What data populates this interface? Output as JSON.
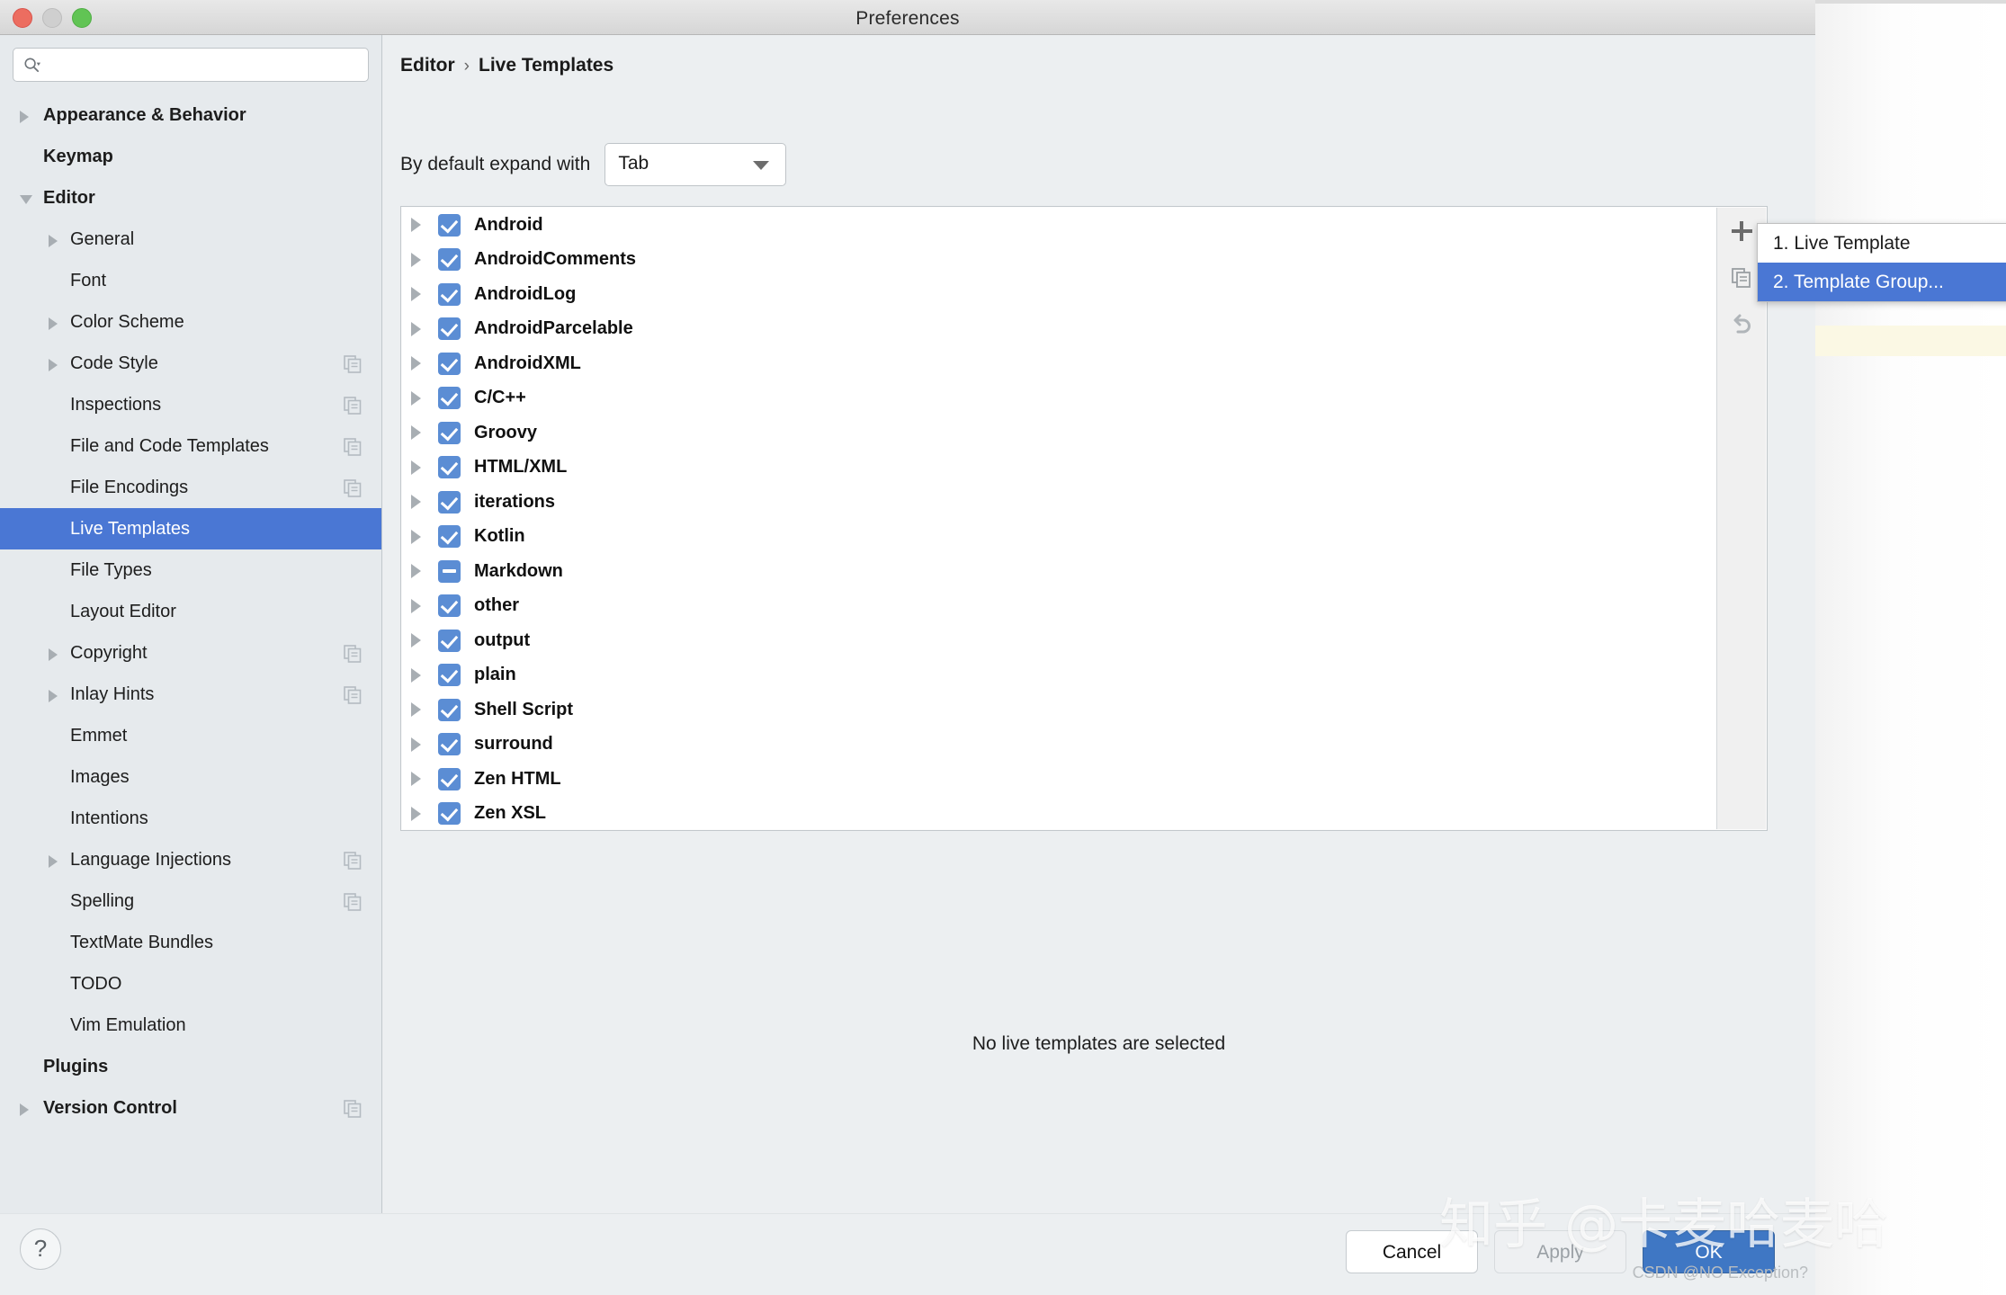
{
  "window": {
    "title": "Preferences",
    "traffic_lights": [
      "close",
      "minimize",
      "maximize"
    ]
  },
  "sidebar": {
    "search": {
      "value": "",
      "placeholder": ""
    },
    "items": [
      {
        "label": "Appearance & Behavior",
        "level": 0,
        "twisty": "closed",
        "bold": true,
        "copy": false,
        "selected": false
      },
      {
        "label": "Keymap",
        "level": 0,
        "twisty": "none",
        "bold": true,
        "copy": false,
        "selected": false
      },
      {
        "label": "Editor",
        "level": 0,
        "twisty": "open",
        "bold": true,
        "copy": false,
        "selected": false
      },
      {
        "label": "General",
        "level": 1,
        "twisty": "closed",
        "bold": false,
        "copy": false,
        "selected": false
      },
      {
        "label": "Font",
        "level": 1,
        "twisty": "none",
        "bold": false,
        "copy": false,
        "selected": false
      },
      {
        "label": "Color Scheme",
        "level": 1,
        "twisty": "closed",
        "bold": false,
        "copy": false,
        "selected": false
      },
      {
        "label": "Code Style",
        "level": 1,
        "twisty": "closed",
        "bold": false,
        "copy": true,
        "selected": false
      },
      {
        "label": "Inspections",
        "level": 1,
        "twisty": "none",
        "bold": false,
        "copy": true,
        "selected": false
      },
      {
        "label": "File and Code Templates",
        "level": 1,
        "twisty": "none",
        "bold": false,
        "copy": true,
        "selected": false
      },
      {
        "label": "File Encodings",
        "level": 1,
        "twisty": "none",
        "bold": false,
        "copy": true,
        "selected": false
      },
      {
        "label": "Live Templates",
        "level": 1,
        "twisty": "none",
        "bold": false,
        "copy": false,
        "selected": true
      },
      {
        "label": "File Types",
        "level": 1,
        "twisty": "none",
        "bold": false,
        "copy": false,
        "selected": false
      },
      {
        "label": "Layout Editor",
        "level": 1,
        "twisty": "none",
        "bold": false,
        "copy": false,
        "selected": false
      },
      {
        "label": "Copyright",
        "level": 1,
        "twisty": "closed",
        "bold": false,
        "copy": true,
        "selected": false
      },
      {
        "label": "Inlay Hints",
        "level": 1,
        "twisty": "closed",
        "bold": false,
        "copy": true,
        "selected": false
      },
      {
        "label": "Emmet",
        "level": 1,
        "twisty": "none",
        "bold": false,
        "copy": false,
        "selected": false
      },
      {
        "label": "Images",
        "level": 1,
        "twisty": "none",
        "bold": false,
        "copy": false,
        "selected": false
      },
      {
        "label": "Intentions",
        "level": 1,
        "twisty": "none",
        "bold": false,
        "copy": false,
        "selected": false
      },
      {
        "label": "Language Injections",
        "level": 1,
        "twisty": "closed",
        "bold": false,
        "copy": true,
        "selected": false
      },
      {
        "label": "Spelling",
        "level": 1,
        "twisty": "none",
        "bold": false,
        "copy": true,
        "selected": false
      },
      {
        "label": "TextMate Bundles",
        "level": 1,
        "twisty": "none",
        "bold": false,
        "copy": false,
        "selected": false
      },
      {
        "label": "TODO",
        "level": 1,
        "twisty": "none",
        "bold": false,
        "copy": false,
        "selected": false
      },
      {
        "label": "Vim Emulation",
        "level": 1,
        "twisty": "none",
        "bold": false,
        "copy": false,
        "selected": false
      },
      {
        "label": "Plugins",
        "level": 0,
        "twisty": "none",
        "bold": true,
        "copy": false,
        "selected": false
      },
      {
        "label": "Version Control",
        "level": 0,
        "twisty": "closed",
        "bold": true,
        "copy": true,
        "selected": false
      }
    ]
  },
  "main": {
    "breadcrumb": {
      "root": "Editor",
      "separator": "›",
      "leaf": "Live Templates"
    },
    "expand_with": {
      "label": "By default expand with",
      "value": "Tab"
    },
    "groups": [
      {
        "name": "Android",
        "state": "checked"
      },
      {
        "name": "AndroidComments",
        "state": "checked"
      },
      {
        "name": "AndroidLog",
        "state": "checked"
      },
      {
        "name": "AndroidParcelable",
        "state": "checked"
      },
      {
        "name": "AndroidXML",
        "state": "checked"
      },
      {
        "name": "C/C++",
        "state": "checked"
      },
      {
        "name": "Groovy",
        "state": "checked"
      },
      {
        "name": "HTML/XML",
        "state": "checked"
      },
      {
        "name": "iterations",
        "state": "checked"
      },
      {
        "name": "Kotlin",
        "state": "checked"
      },
      {
        "name": "Markdown",
        "state": "indeterminate"
      },
      {
        "name": "other",
        "state": "checked"
      },
      {
        "name": "output",
        "state": "checked"
      },
      {
        "name": "plain",
        "state": "checked"
      },
      {
        "name": "Shell Script",
        "state": "checked"
      },
      {
        "name": "surround",
        "state": "checked"
      },
      {
        "name": "Zen HTML",
        "state": "checked"
      },
      {
        "name": "Zen XSL",
        "state": "checked"
      }
    ],
    "toolbar": [
      {
        "icon": "plus-icon",
        "name": "add-template-button"
      },
      {
        "icon": "copy-icon",
        "name": "duplicate-template-button"
      },
      {
        "icon": "revert-icon",
        "name": "restore-defaults-button"
      }
    ],
    "empty_message": "No live templates are selected"
  },
  "add_popup": {
    "items": [
      {
        "label": "1. Live Template",
        "active": false
      },
      {
        "label": "2. Template Group...",
        "active": true
      }
    ]
  },
  "footer": {
    "help": "?",
    "cancel": "Cancel",
    "apply": "Apply",
    "ok": "OK"
  },
  "watermarks": {
    "zhihu": "知乎 @卡麦哈麦哈",
    "csdn": "CSDN @NO Exception?"
  },
  "colors": {
    "selection_blue": "#4a77d4",
    "checkbox_blue": "#5b8dd4",
    "ok_blue": "#3f77c4",
    "sidebar_bg": "#e6eaed",
    "pane_bg": "#eceff1"
  }
}
